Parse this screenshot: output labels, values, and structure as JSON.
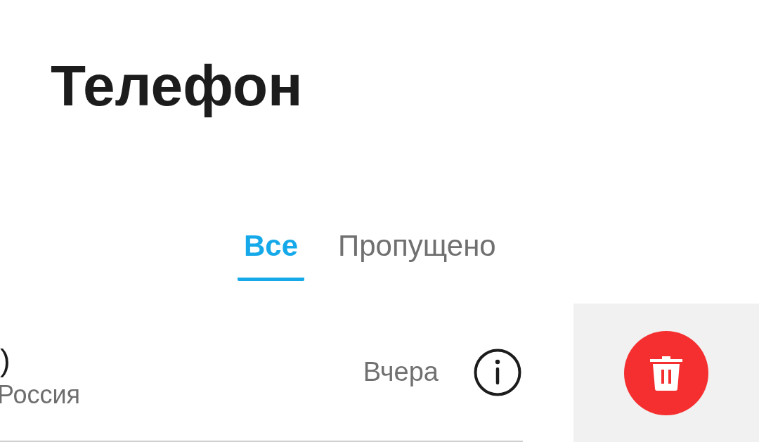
{
  "title": "Телефон",
  "tabs": [
    {
      "label": "Все",
      "selected": true
    },
    {
      "label": "Пропущено",
      "selected": false
    }
  ],
  "call": {
    "name": ")",
    "location": "Россия",
    "time": "Вчера"
  }
}
